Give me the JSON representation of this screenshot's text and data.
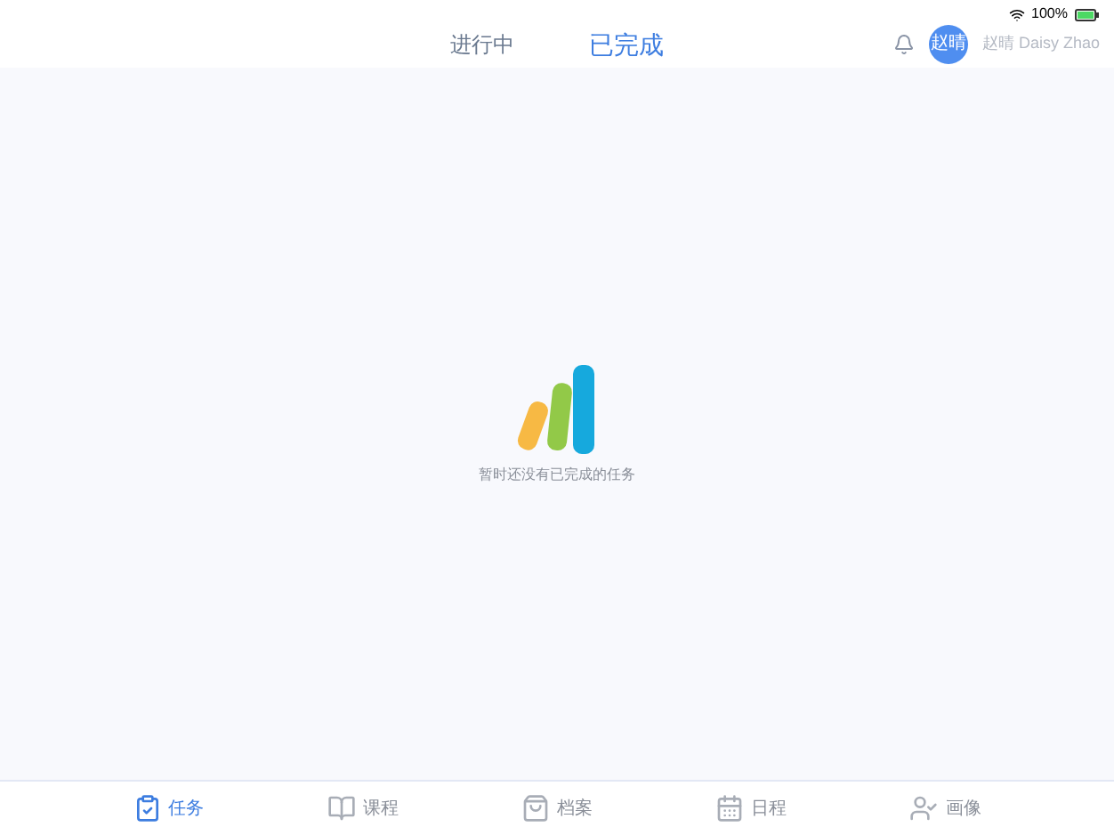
{
  "status_bar": {
    "battery": "100%"
  },
  "tabs": [
    {
      "label": "进行中",
      "selected": false
    },
    {
      "label": "已完成",
      "selected": true
    }
  ],
  "user": {
    "avatar": "赵晴",
    "name": "赵晴 Daisy Zhao"
  },
  "empty_state": {
    "message": "暂时还没有已完成的任务"
  },
  "bottom_nav": [
    {
      "label": "任务",
      "selected": true,
      "kind": "task"
    },
    {
      "label": "课程",
      "selected": false,
      "kind": "course"
    },
    {
      "label": "档案",
      "selected": false,
      "kind": "archive"
    },
    {
      "label": "日程",
      "selected": false,
      "kind": "calendar"
    },
    {
      "label": "画像",
      "selected": false,
      "kind": "profile"
    }
  ]
}
